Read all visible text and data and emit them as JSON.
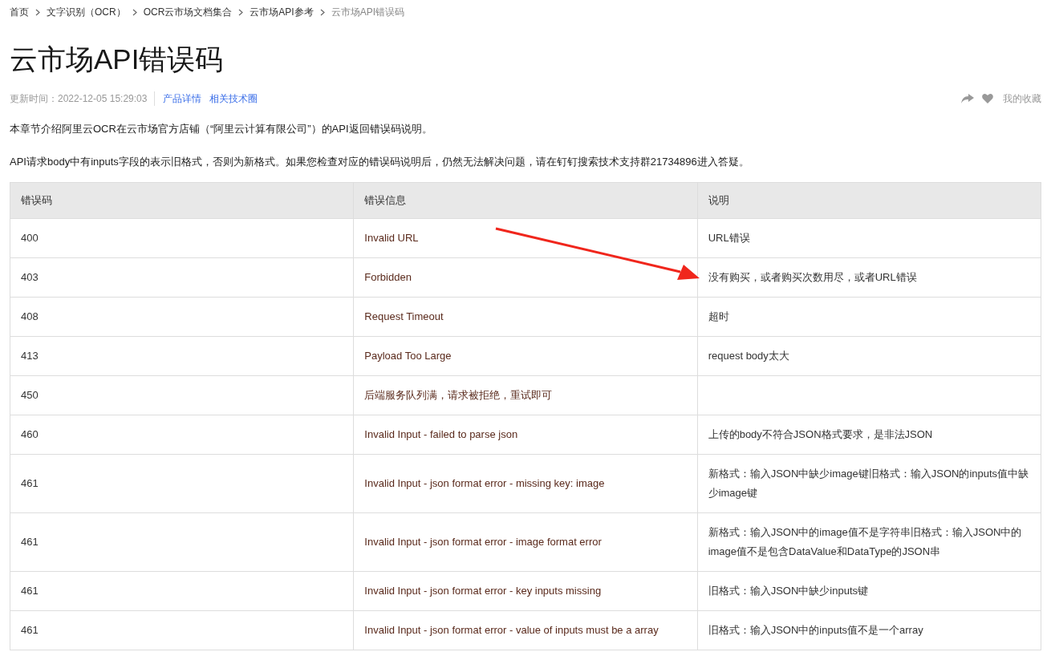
{
  "breadcrumb": [
    {
      "label": "首页",
      "current": false
    },
    {
      "label": "文字识别（OCR）",
      "current": false
    },
    {
      "label": "OCR云市场文档集合",
      "current": false
    },
    {
      "label": "云市场API参考",
      "current": false
    },
    {
      "label": "云市场API错误码",
      "current": true
    }
  ],
  "title": "云市场API错误码",
  "meta": {
    "updated": "更新时间：2022-12-05 15:29:03",
    "links": [
      "产品详情",
      "相关技术圈"
    ],
    "favorite": "我的收藏"
  },
  "paragraphs": [
    "本章节介绍阿里云OCR在云市场官方店铺（“阿里云计算有限公司”）的API返回错误码说明。",
    "API请求body中有inputs字段的表示旧格式，否则为新格式。如果您检查对应的错误码说明后，仍然无法解决问题，请在钉钉搜索技术支持群21734896进入答疑。"
  ],
  "table": {
    "columns": [
      "错误码",
      "错误信息",
      "说明"
    ],
    "rows": [
      [
        "400",
        "Invalid URL",
        "URL错误"
      ],
      [
        "403",
        "Forbidden",
        "没有购买，或者购买次数用尽，或者URL错误"
      ],
      [
        "408",
        "Request Timeout",
        "超时"
      ],
      [
        "413",
        "Payload Too Large",
        "request body太大"
      ],
      [
        "450",
        "后端服务队列满，请求被拒绝，重试即可",
        ""
      ],
      [
        "460",
        "Invalid Input - failed to parse json",
        "上传的body不符合JSON格式要求，是非法JSON"
      ],
      [
        "461",
        "Invalid Input - json format error - missing key: image",
        "新格式：输入JSON中缺少image键旧格式：输入JSON的inputs值中缺少image键"
      ],
      [
        "461",
        "Invalid Input - json format error - image format error",
        "新格式：输入JSON中的image值不是字符串旧格式：输入JSON中的image值不是包含DataValue和DataType的JSON串"
      ],
      [
        "461",
        "Invalid Input - json format error - key inputs missing",
        "旧格式：输入JSON中缺少inputs键"
      ],
      [
        "461",
        "Invalid Input - json format error - value of inputs must be a array",
        "旧格式：输入JSON中的inputs值不是一个array"
      ]
    ]
  }
}
